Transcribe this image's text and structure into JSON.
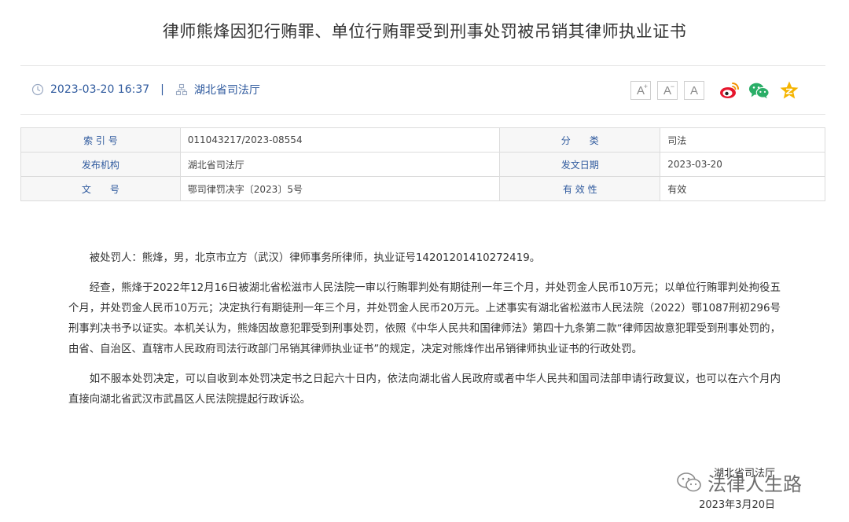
{
  "title": "律师熊烽因犯行贿罪、单位行贿罪受到刑事处罚被吊销其律师执业证书",
  "meta": {
    "datetime": "2023-03-20 16:37",
    "separator": "|",
    "source": "湖北省司法厅"
  },
  "tools": {
    "font_increase": "A",
    "font_decrease": "A",
    "font_reset": "A",
    "share_icons": [
      "weibo-icon",
      "wechat-icon",
      "qzone-icon"
    ]
  },
  "info_table": {
    "rows": [
      {
        "label1": "索 引 号",
        "value1": "011043217/2023-08554",
        "label2": "分　　类",
        "value2": "司法"
      },
      {
        "label1": "发布机构",
        "value1": "湖北省司法厅",
        "label2": "发文日期",
        "value2": "2023-03-20"
      },
      {
        "label1": "文　　号",
        "value1": "鄂司律罚决字〔2023〕5号",
        "label2": "有 效 性",
        "value2": "有效"
      }
    ]
  },
  "body": {
    "paragraphs": [
      "被处罚人：熊烽，男，北京市立方（武汉）律师事务所律师，执业证号14201201410272419。",
      "经查，熊烽于2022年12月16日被湖北省松滋市人民法院一审以行贿罪判处有期徒刑一年三个月，并处罚金人民币10万元；以单位行贿罪判处拘役五个月，并处罚金人民币10万元；决定执行有期徒刑一年三个月，并处罚金人民币20万元。上述事实有湖北省松滋市人民法院（2022）鄂1087刑初296号刑事判决书予以证实。本机关认为，熊烽因故意犯罪受到刑事处罚，依照《中华人民共和国律师法》第四十九条第二款“律师因故意犯罪受到刑事处罚的，由省、自治区、直辖市人民政府司法行政部门吊销其律师执业证书”的规定，决定对熊烽作出吊销律师执业证书的行政处罚。",
      "如不服本处罚决定，可以自收到本处罚决定书之日起六十日内，依法向湖北省人民政府或者中华人民共和国司法部申请行政复议，也可以在六个月内直接向湖北省武汉市武昌区人民法院提起行政诉讼。"
    ]
  },
  "signature": {
    "org": "湖北省司法厅",
    "date": "2023年3月20日"
  },
  "watermark": {
    "text": "法律人生路"
  },
  "colors": {
    "accent": "#2f5a9e",
    "weibo": "#e6162d",
    "wechat": "#2aae67",
    "qzone": "#f5b400"
  }
}
